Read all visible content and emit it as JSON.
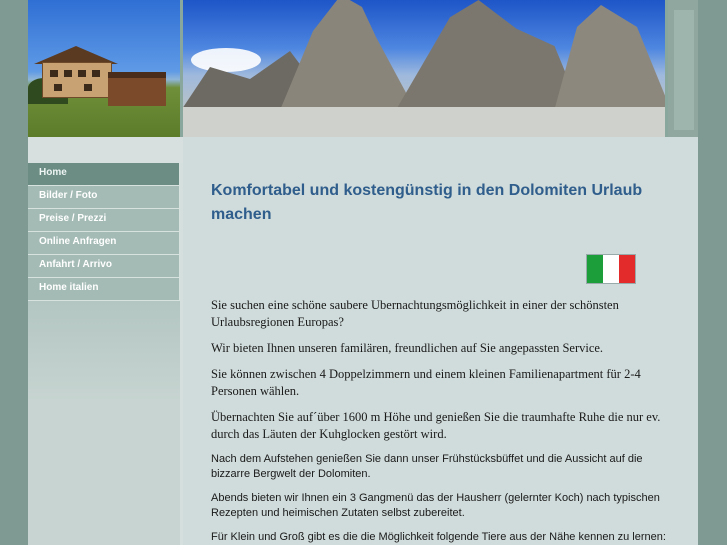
{
  "nav": {
    "items": [
      {
        "label": "Home"
      },
      {
        "label": "Bilder / Foto"
      },
      {
        "label": "Preise / Prezzi"
      },
      {
        "label": "Online Anfragen"
      },
      {
        "label": "Anfahrt / Arrivo"
      },
      {
        "label": "Home italien"
      }
    ]
  },
  "content": {
    "title": "Komfortabel und kostengünstig in den Dolomiten Urlaub machen",
    "paragraphs_serif": [
      "Sie suchen eine schöne saubere Ubernachtungsmöglichkeit in einer der schönsten Urlaubsregionen Europas?",
      "Wir bieten Ihnen unseren familären, freundlichen auf Sie angepassten Service.",
      "Sie können zwischen 4 Doppelzimmern und einem kleinen Familienapartment für 2-4 Personen wählen.",
      "Übernachten Sie auf´über 1600 m Höhe und genießen Sie die traumhafte Ruhe die nur ev. durch das Läuten der Kuhglocken gestört wird."
    ],
    "paragraphs_sans": [
      "Nach dem Aufstehen genießen Sie dann unser Frühstücksbüffet und die Aussicht auf die bizzarre Bergwelt der Dolomiten.",
      "Abends bieten wir Ihnen ein 3 Gangmenü das der Hausherr (gelernter Koch) nach typischen Rezepten und heimischen Zutaten selbst zubereitet.",
      "Für Klein und Groß gibt es die die Möglichkeit folgende Tiere aus der Nähe kennen zu lernen:"
    ]
  },
  "icons": {
    "flag": "italian-flag-icon"
  },
  "colors": {
    "title": "#2f5d8c",
    "nav_active": "#6b8d84",
    "nav_item": "#a4bbb5",
    "page_bg": "#7f9a92"
  }
}
